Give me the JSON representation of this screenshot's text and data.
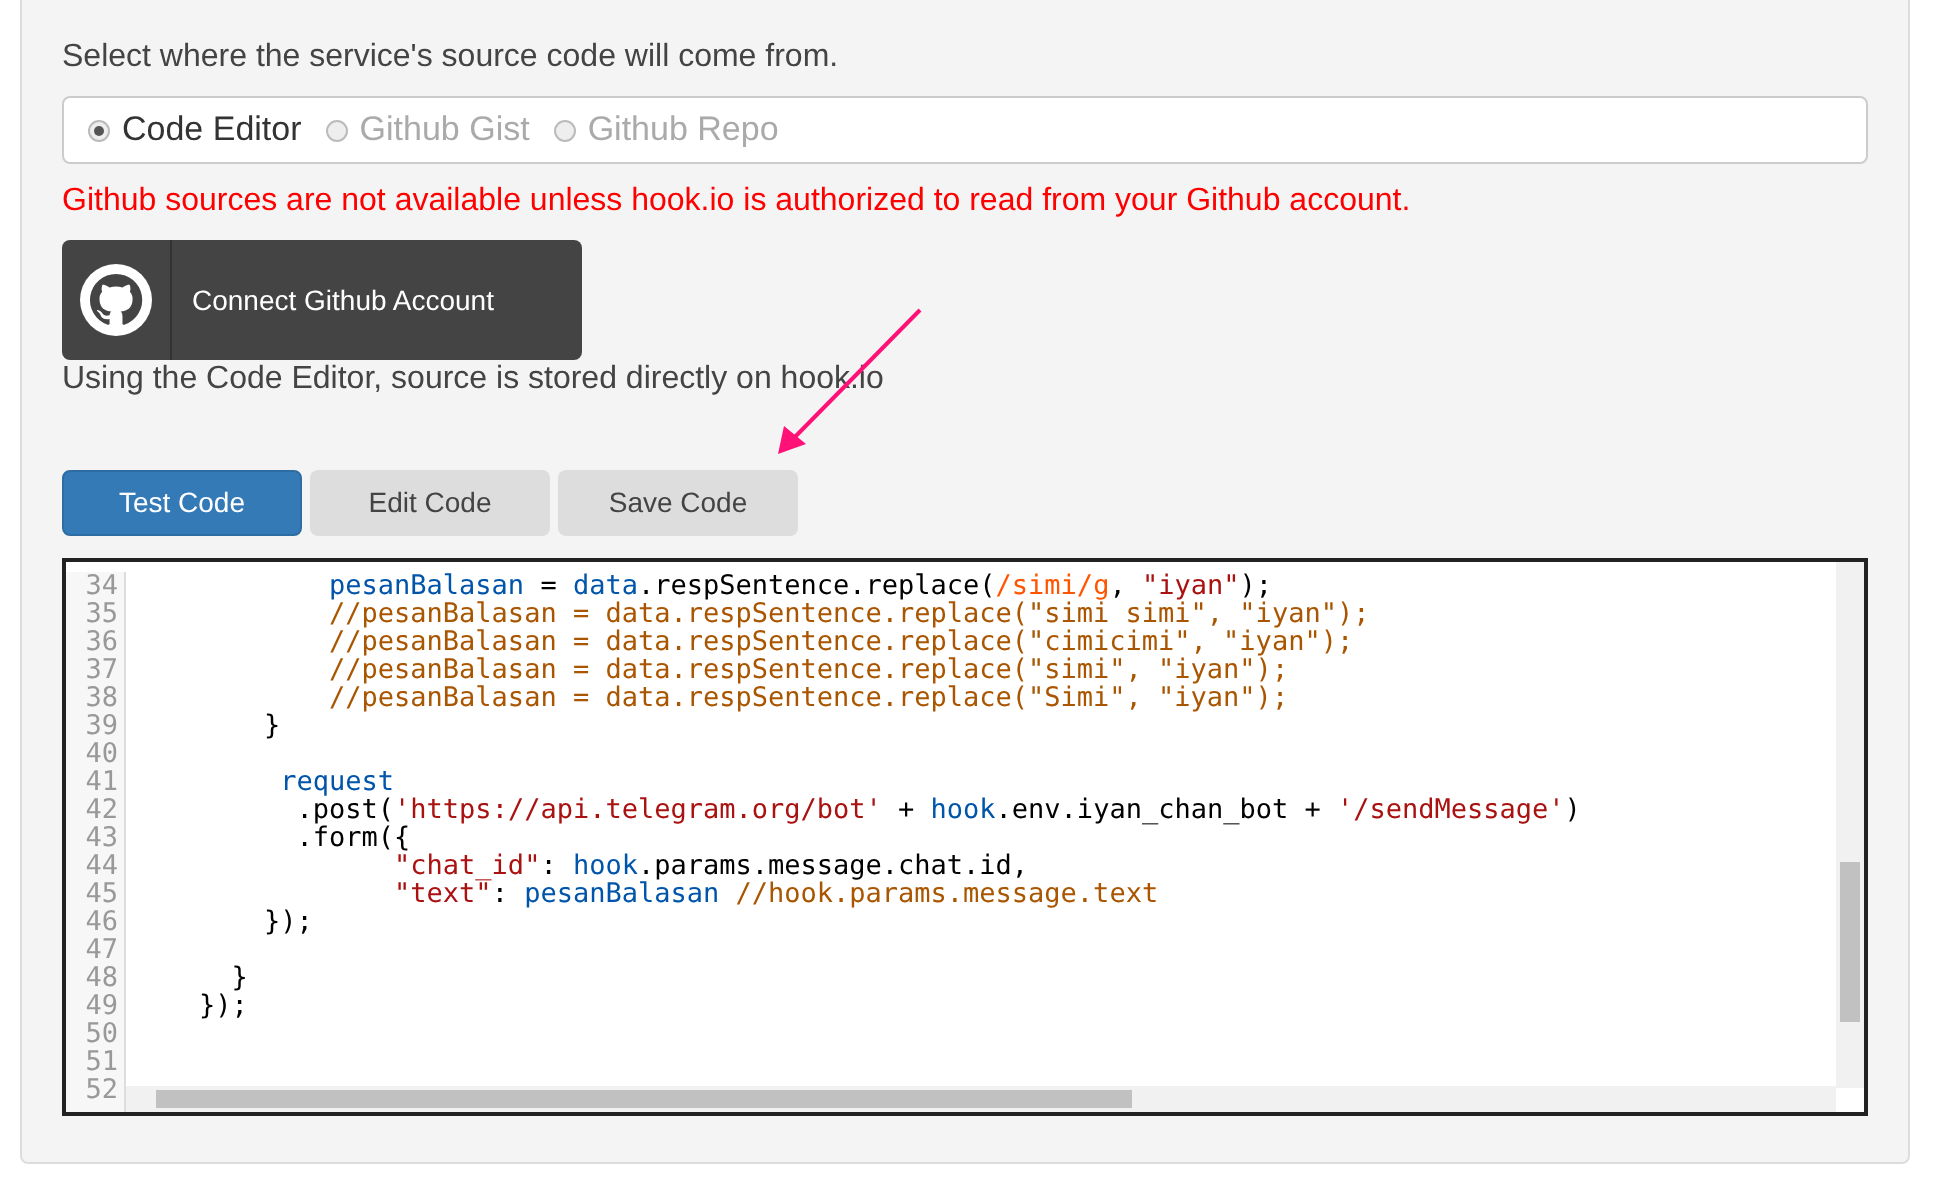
{
  "intro": "Select where the service's source code will come from.",
  "sources": [
    {
      "label": "Code Editor",
      "selected": true,
      "disabled": false
    },
    {
      "label": "Github Gist",
      "selected": false,
      "disabled": true
    },
    {
      "label": "Github Repo",
      "selected": false,
      "disabled": true
    }
  ],
  "warning": "Github sources are not available unless hook.io is authorized to read from your Github account.",
  "connect_button": "Connect Github Account",
  "note": "Using the Code Editor, source is stored directly on hook.io",
  "actions": [
    {
      "label": "Test Code",
      "primary": true
    },
    {
      "label": "Edit Code",
      "primary": false
    },
    {
      "label": "Save Code",
      "primary": false
    }
  ],
  "editor": {
    "lines": [
      {
        "number": "34",
        "tokens": [
          {
            "kind": "variable",
            "text": "            pesanBalasan"
          },
          {
            "kind": "plain",
            "text": " = "
          },
          {
            "kind": "variable",
            "text": "data"
          },
          {
            "kind": "plain",
            "text": ".respSentence.replace("
          },
          {
            "kind": "regex",
            "text": "/simi/g"
          },
          {
            "kind": "plain",
            "text": ", "
          },
          {
            "kind": "string",
            "text": "\"iyan\""
          },
          {
            "kind": "plain",
            "text": ");"
          }
        ]
      },
      {
        "number": "35",
        "tokens": [
          {
            "kind": "comment",
            "text": "            //pesanBalasan = data.respSentence.replace(\"simi simi\", \"iyan\");"
          }
        ]
      },
      {
        "number": "36",
        "tokens": [
          {
            "kind": "comment",
            "text": "            //pesanBalasan = data.respSentence.replace(\"cimicimi\", \"iyan\");"
          }
        ]
      },
      {
        "number": "37",
        "tokens": [
          {
            "kind": "comment",
            "text": "            //pesanBalasan = data.respSentence.replace(\"simi\", \"iyan\");"
          }
        ]
      },
      {
        "number": "38",
        "tokens": [
          {
            "kind": "comment",
            "text": "            //pesanBalasan = data.respSentence.replace(\"Simi\", \"iyan\");"
          }
        ]
      },
      {
        "number": "39",
        "tokens": [
          {
            "kind": "plain",
            "text": "        }"
          }
        ]
      },
      {
        "number": "40"
      },
      {
        "number": "41",
        "tokens": [
          {
            "kind": "variable",
            "text": "         request"
          }
        ]
      },
      {
        "number": "42",
        "tokens": [
          {
            "kind": "plain",
            "text": "          .post("
          },
          {
            "kind": "string",
            "text": "'https://api.telegram.org/bot'"
          },
          {
            "kind": "plain",
            "text": " + "
          },
          {
            "kind": "variable",
            "text": "hook"
          },
          {
            "kind": "plain",
            "text": ".env.iyan_chan_bot + "
          },
          {
            "kind": "string",
            "text": "'/sendMessage'"
          },
          {
            "kind": "plain",
            "text": ")"
          }
        ]
      },
      {
        "number": "43",
        "tokens": [
          {
            "kind": "plain",
            "text": "          .form({"
          }
        ]
      },
      {
        "number": "44",
        "tokens": [
          {
            "kind": "string",
            "text": "                \"chat_id\""
          },
          {
            "kind": "plain",
            "text": ": "
          },
          {
            "kind": "variable",
            "text": "hook"
          },
          {
            "kind": "plain",
            "text": ".params.message.chat.id,"
          }
        ]
      },
      {
        "number": "45",
        "tokens": [
          {
            "kind": "string",
            "text": "                \"text\""
          },
          {
            "kind": "plain",
            "text": ": "
          },
          {
            "kind": "variable",
            "text": "pesanBalasan"
          },
          {
            "kind": "comment",
            "text": " //hook.params.message.text"
          }
        ]
      },
      {
        "number": "46",
        "tokens": [
          {
            "kind": "plain",
            "text": "        });"
          }
        ]
      },
      {
        "number": "47"
      },
      {
        "number": "48",
        "tokens": [
          {
            "kind": "plain",
            "text": "      }"
          }
        ]
      },
      {
        "number": "49",
        "tokens": [
          {
            "kind": "plain",
            "text": "    });"
          }
        ]
      },
      {
        "number": "50"
      },
      {
        "number": "51"
      },
      {
        "number": "52"
      }
    ]
  }
}
